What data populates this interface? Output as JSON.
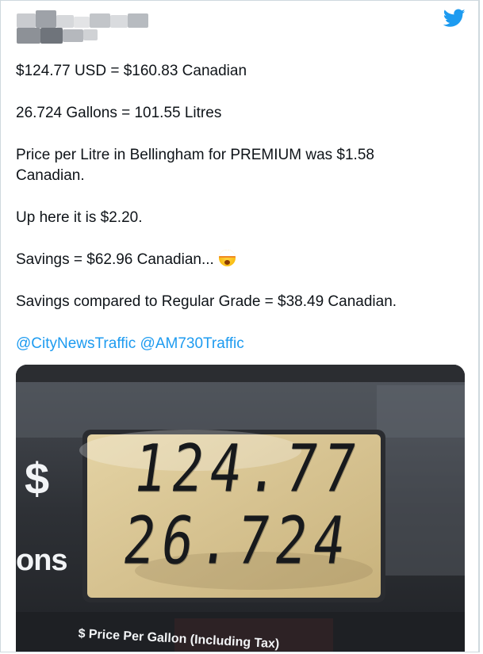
{
  "tweet": {
    "lines": [
      "$124.77 USD = $160.83 Canadian",
      "26.724 Gallons = 101.55 Litres",
      "Price per Litre in Bellingham for PREMIUM was $1.58",
      "Canadian.",
      "Up here it is $2.20.",
      "Savings = $62.96 Canadian...",
      "Savings compared to Regular Grade = $38.49 Canadian."
    ],
    "emoji": "exploding-head-emoji",
    "mentions": [
      "@CityNewsTraffic",
      "@AM730Traffic"
    ]
  },
  "photo": {
    "dollar_sign": "$",
    "gallons_fragment": "ons",
    "amount_readout": "124.77",
    "gallons_readout": "26.724",
    "caption": "$ Price Per Gallon (Including Tax)"
  },
  "icons": {
    "twitter": "twitter-bird-icon",
    "twitter_color": "#1d9bf0"
  },
  "colors": {
    "text": "#0f1419",
    "link": "#1d9bf0",
    "display_background": "#d9c79a"
  }
}
